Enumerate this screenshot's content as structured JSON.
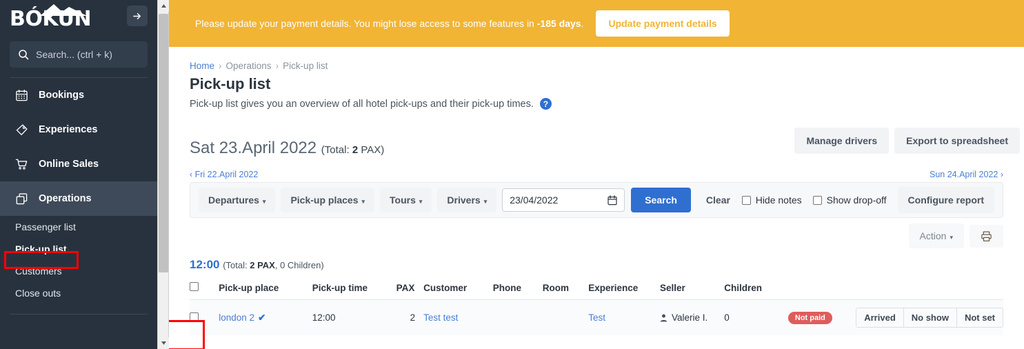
{
  "sidebar": {
    "logo_text": "BÓKUN",
    "collapse_icon": "arrow-right-icon",
    "search_placeholder": "Search... (ctrl + k)",
    "nav": [
      {
        "label": "Bookings",
        "icon": "calendar-icon",
        "active": false
      },
      {
        "label": "Experiences",
        "icon": "tag-icon",
        "active": false
      },
      {
        "label": "Online Sales",
        "icon": "shopping-cart-icon",
        "active": false
      },
      {
        "label": "Operations",
        "icon": "copy-stack-icon",
        "active": true
      }
    ],
    "sub_items": [
      {
        "label": "Passenger list",
        "current": false
      },
      {
        "label": "Pick-up list",
        "current": true
      },
      {
        "label": "Customers",
        "current": false
      },
      {
        "label": "Close outs",
        "current": false
      }
    ]
  },
  "banner": {
    "text_before": "Please update your payment details. You might lose access to some features in ",
    "days": "-185 days",
    "text_after": ".",
    "button_label": "Update payment details",
    "color": "#f1b434"
  },
  "breadcrumb": {
    "home": "Home",
    "operations": "Operations",
    "current": "Pick-up list",
    "separator": "›"
  },
  "header": {
    "title": "Pick-up list",
    "description": "Pick-up list gives you an overview of all hotel pick-ups and their pick-up times.",
    "help_icon": "question-circle-icon",
    "manage_drivers": "Manage drivers",
    "export_spreadsheet": "Export to spreadsheet"
  },
  "day": {
    "heading": "Sat 23.April 2022",
    "total_prefix": "(Total: ",
    "total_value": "2",
    "total_suffix": " PAX)",
    "prev_link": "‹ Fri 22.April 2022",
    "next_link": "Sun 24.April 2022 ›"
  },
  "filters": {
    "departures": "Departures",
    "pickup_places": "Pick-up places",
    "tours": "Tours",
    "drivers": "Drivers",
    "date_value": "23/04/2022",
    "date_icon": "calendar-icon",
    "search": "Search",
    "clear": "Clear",
    "hide_notes": "Hide notes",
    "hide_notes_checked": false,
    "show_dropoff": "Show drop-off",
    "show_dropoff_checked": false,
    "configure_report": "Configure report",
    "caret": "▾"
  },
  "actions": {
    "action_label": "Action",
    "print_icon": "printer-icon"
  },
  "group": {
    "time": "12:00",
    "total_prefix": "(Total: ",
    "total_pax": "2 PAX",
    "children_text": ", 0 Children)"
  },
  "table": {
    "columns": [
      "Pick-up place",
      "Pick-up time",
      "PAX",
      "Customer",
      "Phone",
      "Room",
      "Experience",
      "Seller",
      "Children"
    ],
    "rows": [
      {
        "pickup_place": "london 2",
        "place_check": "✔",
        "pickup_time": "12:00",
        "pax": "2",
        "customer": "Test test",
        "phone": "",
        "room": "",
        "experience": "Test",
        "seller": "Valerie I.",
        "seller_icon": "person-icon",
        "children": "0",
        "payment_badge": "Not paid",
        "badge_color": "#e05c5c",
        "status_buttons": [
          "Arrived",
          "No show",
          "Not set"
        ]
      }
    ]
  },
  "annotations": {
    "sidebar_highlight": "Pick-up list",
    "row_checkbox_highlight": "row-checkbox",
    "color": "#ff0000"
  }
}
